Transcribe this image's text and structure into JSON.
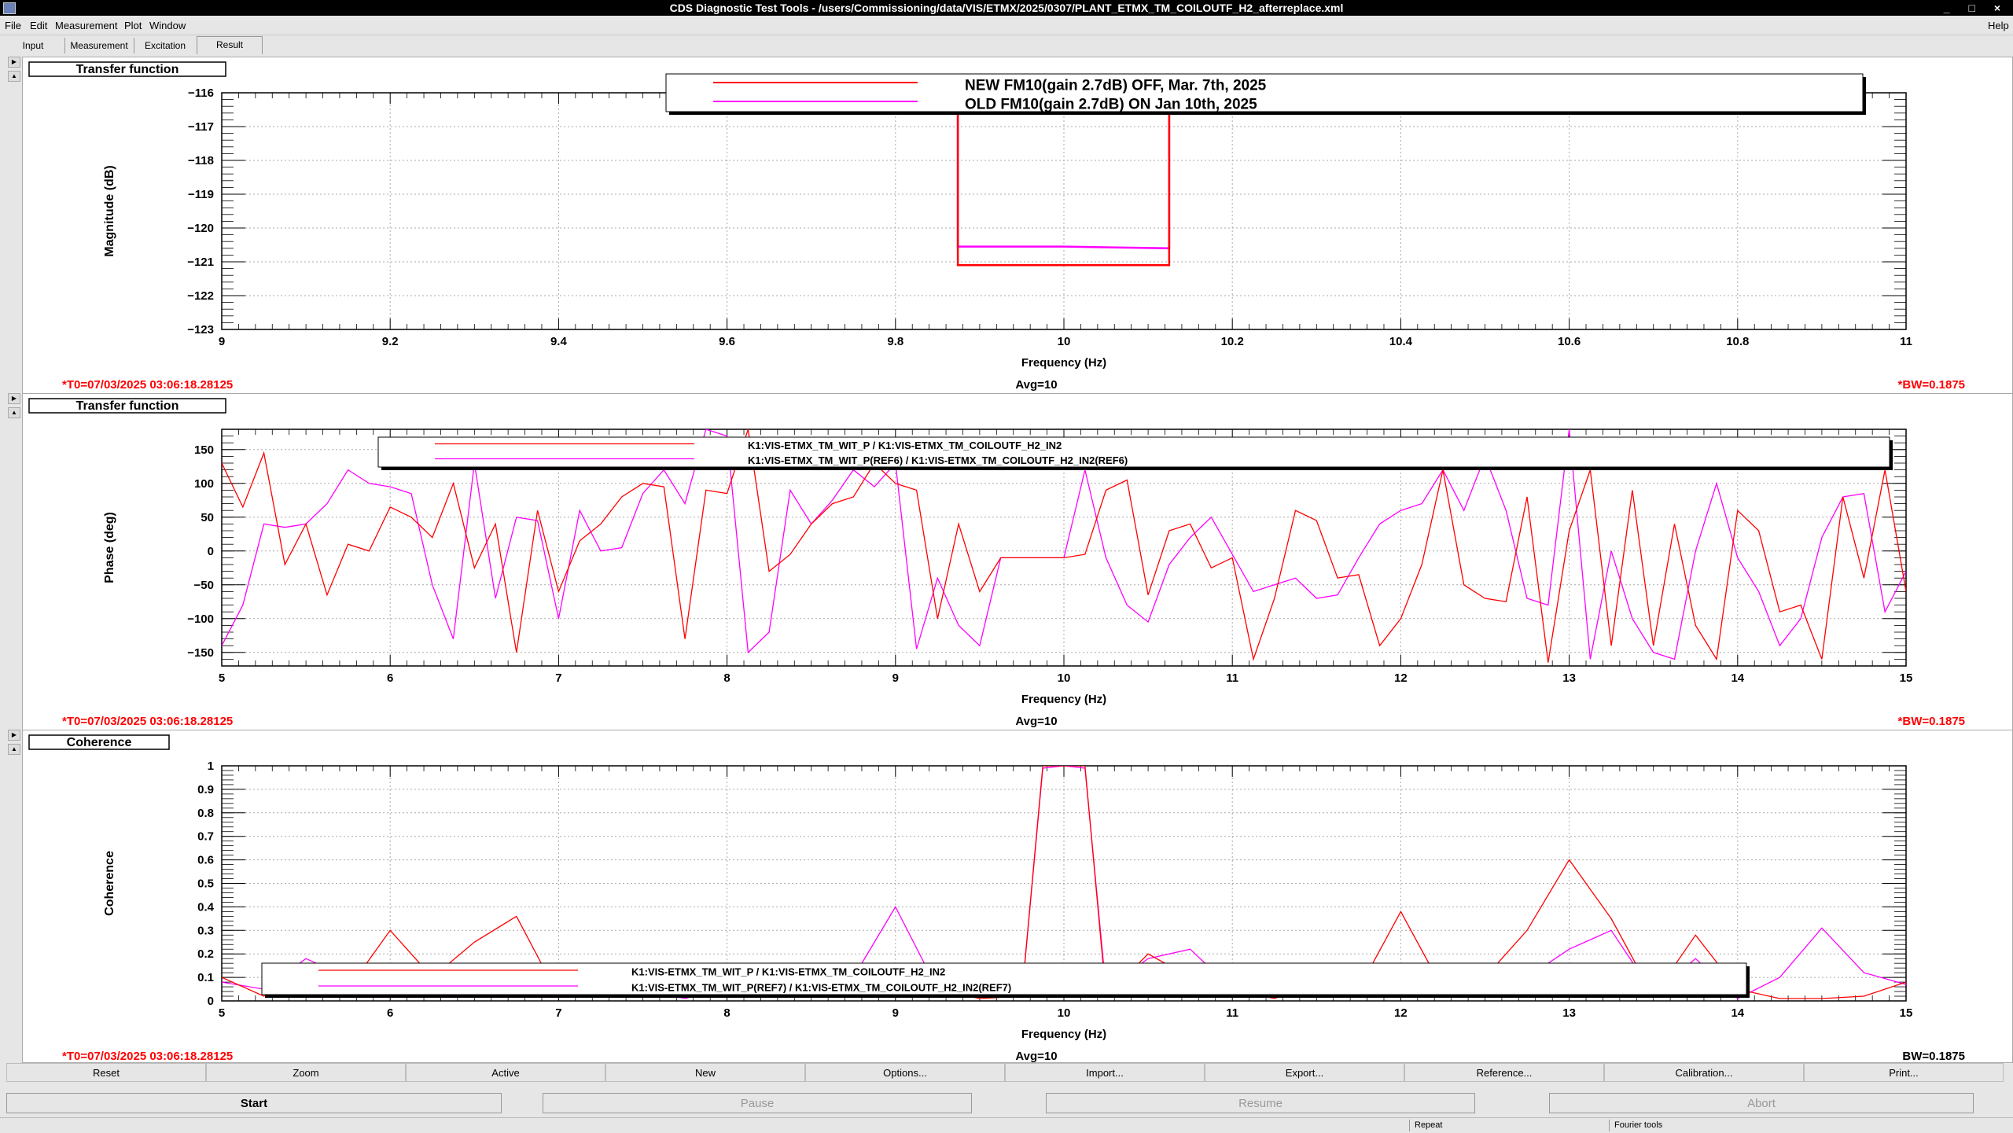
{
  "window": {
    "title": "CDS Diagnostic Test Tools - /users/Commissioning/data/VIS/ETMX/2025/0307/PLANT_ETMX_TM_COILOUTF_H2_afterreplace.xml",
    "controls": "_ □ ×"
  },
  "menu": {
    "file": "File",
    "edit": "Edit",
    "measurement": "Measurement",
    "plot": "Plot",
    "window": "Window",
    "help": "Help"
  },
  "tabs": [
    "Input",
    "Measurement",
    "Excitation",
    "Result"
  ],
  "active_tab": "Result",
  "colors": {
    "new": "#ff0000",
    "old": "#ff00ff",
    "status": "#ff0000"
  },
  "panels": [
    {
      "title": "Transfer function",
      "t0": "*T0=07/03/2025 03:06:18.28125",
      "avg": "Avg=10",
      "bw": "*BW=0.1875",
      "legend": [
        "NEW FM10(gain 2.7dB) OFF, Mar. 7th, 2025",
        "OLD FM10(gain 2.7dB) ON Jan 10th, 2025"
      ]
    },
    {
      "title": "Transfer function",
      "t0": "*T0=07/03/2025 03:06:18.28125",
      "avg": "Avg=10",
      "bw": "*BW=0.1875",
      "legend": [
        "K1:VIS-ETMX_TM_WIT_P / K1:VIS-ETMX_TM_COILOUTF_H2_IN2",
        "K1:VIS-ETMX_TM_WIT_P(REF6) / K1:VIS-ETMX_TM_COILOUTF_H2_IN2(REF6)"
      ]
    },
    {
      "title": "Coherence",
      "t0": "*T0=07/03/2025 03:06:18.28125",
      "avg": "Avg=10",
      "bw": "BW=0.1875",
      "legend": [
        "K1:VIS-ETMX_TM_WIT_P / K1:VIS-ETMX_TM_COILOUTF_H2_IN2",
        "K1:VIS-ETMX_TM_WIT_P(REF7) / K1:VIS-ETMX_TM_COILOUTF_H2_IN2(REF7)"
      ]
    }
  ],
  "chart_data": [
    {
      "type": "line",
      "xlabel": "Frequency (Hz)",
      "ylabel": "Magnitude (dB)",
      "xlim": [
        9,
        11
      ],
      "ylim": [
        -123,
        -116
      ],
      "grid": true,
      "legend_position": "top",
      "xticks": [
        9,
        9.2,
        9.4,
        9.6,
        9.8,
        10,
        10.2,
        10.4,
        10.6,
        10.8,
        11
      ],
      "xticklabels": [
        "9",
        "9.2",
        "9.4",
        "9.6",
        "9.8",
        "10",
        "10.2",
        "10.4",
        "10.6",
        "10.8",
        "11"
      ],
      "yticks": [
        -123,
        -122,
        -121,
        -120,
        -119,
        -118,
        -117,
        -116
      ],
      "yticklabels": [
        "−123",
        "−122",
        "−121",
        "−120",
        "−119",
        "−118",
        "−117",
        "−116"
      ],
      "series": [
        {
          "name": "NEW FM10(gain 2.7dB) OFF, Mar. 7th, 2025",
          "color": "#ff0000",
          "x": [
            9.874,
            9.874,
            10.125,
            10.125
          ],
          "y": [
            -116.6,
            -121.1,
            -121.1,
            -116.6
          ]
        },
        {
          "name": "OLD FM10(gain 2.7dB) ON Jan 10th, 2025",
          "color": "#ff00ff",
          "x": [
            9.874,
            9.874,
            10.0,
            10.125,
            10.125
          ],
          "y": [
            -116.6,
            -120.55,
            -120.55,
            -120.6,
            -116.6
          ]
        }
      ]
    },
    {
      "type": "line",
      "xlabel": "Frequency (Hz)",
      "ylabel": "Phase (deg)",
      "xlim": [
        5,
        15
      ],
      "ylim": [
        -170,
        180
      ],
      "grid": true,
      "legend_position": "top",
      "xticks": [
        5,
        6,
        7,
        8,
        9,
        10,
        11,
        12,
        13,
        14,
        15
      ],
      "xticklabels": [
        "5",
        "6",
        "7",
        "8",
        "9",
        "10",
        "11",
        "12",
        "13",
        "14",
        "15"
      ],
      "yticks": [
        -150,
        -100,
        -50,
        0,
        50,
        100,
        150
      ],
      "yticklabels": [
        "−150",
        "−100",
        "−50",
        "0",
        "50",
        "100",
        "150"
      ],
      "series": [
        {
          "name": "K1:VIS-ETMX_TM_WIT_P / K1:VIS-ETMX_TM_COILOUTF_H2_IN2",
          "color": "#ff0000",
          "x": [
            5,
            5.125,
            5.25,
            5.375,
            5.5,
            5.625,
            5.75,
            5.875,
            6,
            6.125,
            6.25,
            6.375,
            6.5,
            6.625,
            6.75,
            6.875,
            7,
            7.125,
            7.25,
            7.375,
            7.5,
            7.625,
            7.75,
            7.875,
            8,
            8.125,
            8.25,
            8.375,
            8.5,
            8.625,
            8.75,
            8.875,
            9,
            9.125,
            9.25,
            9.375,
            9.5,
            9.625,
            9.75,
            9.875,
            10,
            10.125,
            10.25,
            10.375,
            10.5,
            10.625,
            10.75,
            10.875,
            11,
            11.125,
            11.25,
            11.375,
            11.5,
            11.625,
            11.75,
            11.875,
            12,
            12.125,
            12.25,
            12.375,
            12.5,
            12.625,
            12.75,
            12.875,
            13,
            13.125,
            13.25,
            13.375,
            13.5,
            13.625,
            13.75,
            13.875,
            14,
            14.125,
            14.25,
            14.375,
            14.5,
            14.625,
            14.75,
            14.875,
            15
          ],
          "y": [
            130,
            65,
            145,
            -20,
            40,
            -65,
            10,
            0,
            65,
            50,
            20,
            100,
            -25,
            40,
            -150,
            60,
            -60,
            15,
            40,
            80,
            100,
            95,
            -130,
            90,
            85,
            180,
            -30,
            -5,
            40,
            70,
            80,
            130,
            100,
            90,
            -100,
            40,
            -60,
            -10,
            -10,
            -10,
            -10,
            -5,
            90,
            105,
            -65,
            30,
            40,
            -25,
            -10,
            -160,
            -70,
            60,
            45,
            -40,
            -35,
            -140,
            -100,
            -20,
            120,
            -50,
            -70,
            -75,
            80,
            -165,
            30,
            120,
            -140,
            90,
            -140,
            40,
            -110,
            -160,
            60,
            30,
            -90,
            -80,
            -160,
            80,
            -40,
            120,
            -60
          ]
        },
        {
          "name": "K1:VIS-ETMX_TM_WIT_P(REF6) / K1:VIS-ETMX_TM_COILOUTF_H2_IN2(REF6)",
          "color": "#ff00ff",
          "x": [
            5,
            5.125,
            5.25,
            5.375,
            5.5,
            5.625,
            5.75,
            5.875,
            6,
            6.125,
            6.25,
            6.375,
            6.5,
            6.625,
            6.75,
            6.875,
            7,
            7.125,
            7.25,
            7.375,
            7.5,
            7.625,
            7.75,
            7.875,
            8,
            8.125,
            8.25,
            8.375,
            8.5,
            8.625,
            8.75,
            8.875,
            9,
            9.125,
            9.25,
            9.375,
            9.5,
            9.625,
            9.75,
            9.875,
            10,
            10.125,
            10.25,
            10.375,
            10.5,
            10.625,
            10.75,
            10.875,
            11,
            11.125,
            11.25,
            11.375,
            11.5,
            11.625,
            11.75,
            11.875,
            12,
            12.125,
            12.25,
            12.375,
            12.5,
            12.625,
            12.75,
            12.875,
            13,
            13.125,
            13.25,
            13.375,
            13.5,
            13.625,
            13.75,
            13.875,
            14,
            14.125,
            14.25,
            14.375,
            14.5,
            14.625,
            14.75,
            14.875,
            15
          ],
          "y": [
            -140,
            -80,
            40,
            35,
            40,
            70,
            120,
            100,
            95,
            85,
            -50,
            -130,
            130,
            -70,
            50,
            45,
            -100,
            60,
            0,
            5,
            85,
            120,
            70,
            180,
            170,
            -150,
            -120,
            90,
            40,
            75,
            120,
            95,
            130,
            -145,
            -40,
            -110,
            -140,
            -10,
            -10,
            -10,
            -10,
            120,
            -10,
            -80,
            -105,
            -20,
            20,
            50,
            -5,
            -60,
            -50,
            -40,
            -70,
            -65,
            -10,
            40,
            60,
            70,
            120,
            60,
            140,
            60,
            -70,
            -80,
            180,
            -160,
            0,
            -100,
            -150,
            -160,
            0,
            100,
            -10,
            -60,
            -140,
            -100,
            20,
            80,
            85,
            -90,
            -30
          ]
        }
      ]
    },
    {
      "type": "line",
      "xlabel": "Frequency (Hz)",
      "ylabel": "Coherence",
      "xlim": [
        5,
        15
      ],
      "ylim": [
        0,
        1
      ],
      "grid": true,
      "legend_position": "bottom",
      "xticks": [
        5,
        6,
        7,
        8,
        9,
        10,
        11,
        12,
        13,
        14,
        15
      ],
      "xticklabels": [
        "5",
        "6",
        "7",
        "8",
        "9",
        "10",
        "11",
        "12",
        "13",
        "14",
        "15"
      ],
      "yticks": [
        0,
        0.1,
        0.2,
        0.3,
        0.4,
        0.5,
        0.6,
        0.7,
        0.8,
        0.9,
        1
      ],
      "yticklabels": [
        "0",
        "0.1",
        "0.2",
        "0.3",
        "0.4",
        "0.5",
        "0.6",
        "0.7",
        "0.8",
        "0.9",
        "1"
      ],
      "series": [
        {
          "name": "K1:VIS-ETMX_TM_WIT_P / K1:VIS-ETMX_TM_COILOUTF_H2_IN2",
          "color": "#ff0000",
          "x": [
            5,
            5.25,
            5.5,
            5.75,
            6,
            6.25,
            6.5,
            6.75,
            7,
            7.25,
            7.5,
            7.75,
            8,
            8.25,
            8.5,
            8.75,
            9,
            9.25,
            9.5,
            9.75,
            9.875,
            10,
            10.125,
            10.25,
            10.5,
            10.75,
            11,
            11.25,
            11.5,
            11.75,
            12,
            12.25,
            12.5,
            12.75,
            13,
            13.25,
            13.5,
            13.75,
            14,
            14.25,
            14.5,
            14.75,
            15
          ],
          "y": [
            0.1,
            0.02,
            0.15,
            0.05,
            0.3,
            0.1,
            0.25,
            0.36,
            0.02,
            0.05,
            0.1,
            0.03,
            0.05,
            0.02,
            0.08,
            0.1,
            0.02,
            0.05,
            0.01,
            0.02,
            1,
            1,
            1,
            0.02,
            0.2,
            0.1,
            0.05,
            0.01,
            0.08,
            0.05,
            0.38,
            0.05,
            0.1,
            0.3,
            0.6,
            0.35,
            0.02,
            0.28,
            0.05,
            0.01,
            0.01,
            0.02,
            0.08
          ]
        },
        {
          "name": "K1:VIS-ETMX_TM_WIT_P(REF7) / K1:VIS-ETMX_TM_COILOUTF_H2_IN2(REF7)",
          "color": "#ff00ff",
          "x": [
            5,
            5.25,
            5.5,
            5.75,
            6,
            6.25,
            6.5,
            6.75,
            7,
            7.25,
            7.5,
            7.75,
            8,
            8.25,
            8.5,
            8.75,
            9,
            9.25,
            9.5,
            9.75,
            9.875,
            10,
            10.125,
            10.25,
            10.5,
            10.75,
            11,
            11.25,
            11.5,
            11.75,
            12,
            12.25,
            12.5,
            12.75,
            13,
            13.25,
            13.5,
            13.75,
            14,
            14.25,
            14.5,
            14.75,
            15
          ],
          "y": [
            0.08,
            0.05,
            0.18,
            0.1,
            0.05,
            0.15,
            0.02,
            0.1,
            0.06,
            0.03,
            0.05,
            0.01,
            0.06,
            0.1,
            0.08,
            0.1,
            0.4,
            0.05,
            0.15,
            0.02,
            0.99,
            1,
            0.99,
            0.05,
            0.18,
            0.22,
            0.05,
            0.1,
            0.05,
            0.06,
            0.12,
            0.04,
            0.02,
            0.1,
            0.22,
            0.3,
            0.03,
            0.18,
            0.01,
            0.1,
            0.31,
            0.12,
            0.07
          ]
        }
      ]
    }
  ],
  "toolbar": [
    "Reset",
    "Zoom",
    "Active",
    "New",
    "Options...",
    "Import...",
    "Export...",
    "Reference...",
    "Calibration...",
    "Print..."
  ],
  "actions": {
    "start": "Start",
    "pause": "Pause",
    "resume": "Resume",
    "abort": "Abort"
  },
  "status": {
    "repeat": "Repeat",
    "fourier": "Fourier tools"
  }
}
